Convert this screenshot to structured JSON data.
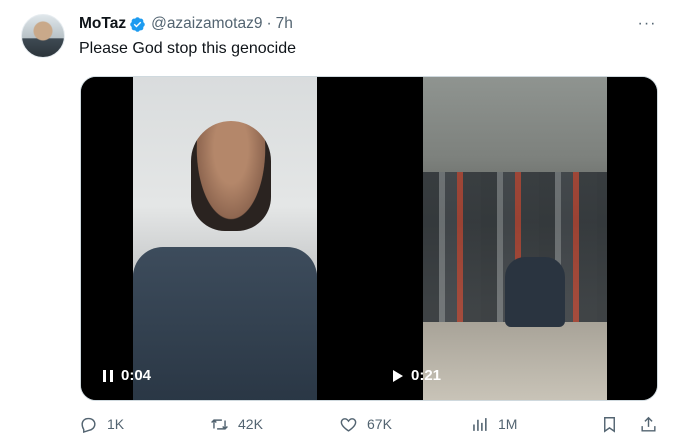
{
  "author": {
    "name": "MoTaz",
    "handle": "@azaizamotaz9",
    "separator": "·",
    "time": "7h",
    "verified_color": "#1d9bf0"
  },
  "more_label": "···",
  "tweet_text": "Please God stop this genocide",
  "videos": [
    {
      "control_icon": "pause-icon",
      "time": "0:04"
    },
    {
      "control_icon": "play-icon",
      "time": "0:21"
    }
  ],
  "actions": {
    "replies": "1K",
    "reposts": "42K",
    "likes": "67K",
    "views": "1M"
  },
  "colors": {
    "text": "#0f1419",
    "secondary": "#536471",
    "accent": "#1d9bf0"
  }
}
